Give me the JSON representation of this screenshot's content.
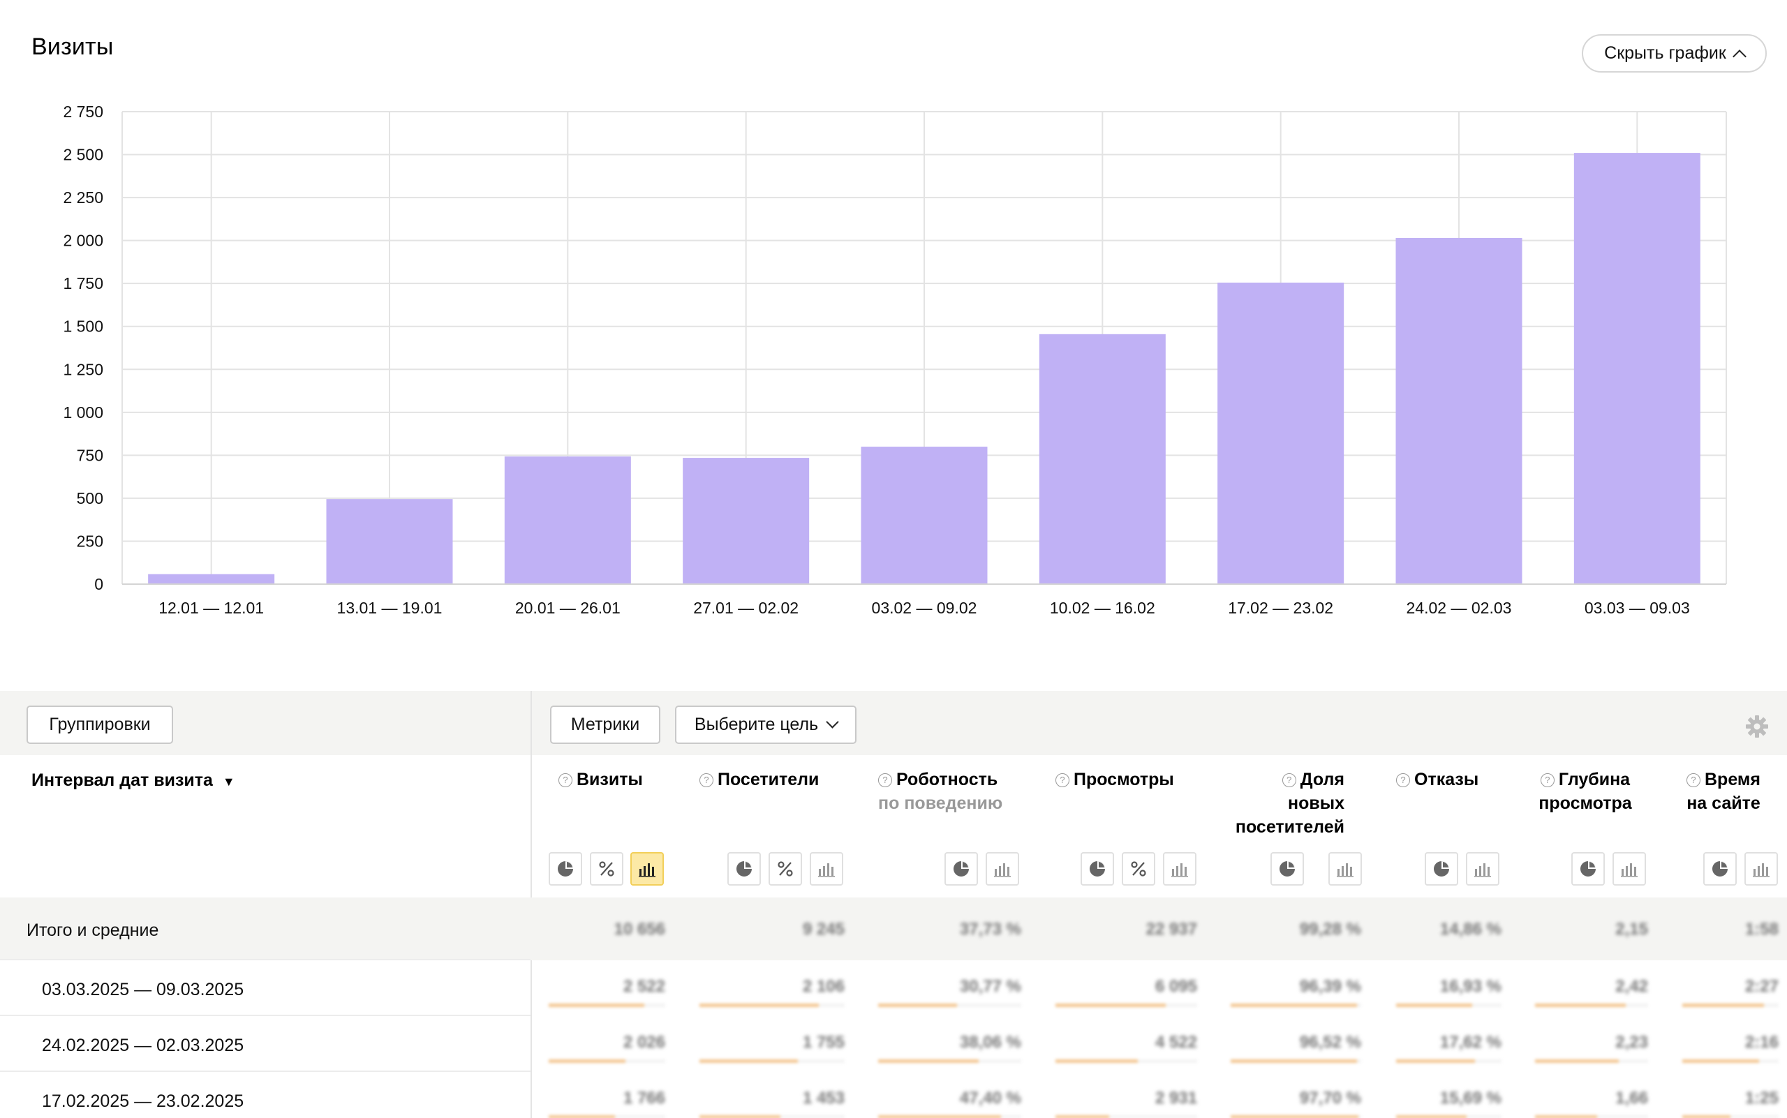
{
  "page": {
    "title": "Визиты",
    "hide_chart_label": "Скрыть график"
  },
  "chart_data": {
    "type": "bar",
    "title": "",
    "categories": [
      "12.01 — 12.01",
      "13.01 — 19.01",
      "20.01 — 26.01",
      "27.01 — 02.02",
      "03.02 — 09.02",
      "10.02 — 16.02",
      "17.02 — 23.02",
      "24.02 — 02.03",
      "03.03 — 09.03"
    ],
    "values": [
      58,
      495,
      743,
      735,
      800,
      1455,
      1755,
      2015,
      2510
    ],
    "yticks": [
      0,
      250,
      500,
      750,
      1000,
      1250,
      1500,
      1750,
      2000,
      2250,
      2500,
      2750
    ],
    "ytick_labels": [
      "0",
      "250",
      "500",
      "750",
      "1 000",
      "1 250",
      "1 500",
      "1 750",
      "2 000",
      "2 250",
      "2 500",
      "2 750"
    ],
    "ylim": [
      0,
      2750
    ],
    "grid": true,
    "color": "#c0b1f5"
  },
  "toolbar": {
    "groupings_label": "Группировки",
    "metrics_label": "Метрики",
    "goal_label": "Выберите цель",
    "settings_icon": "gear-icon"
  },
  "table": {
    "dimension_header": "Интервал дат визита",
    "sort_indicator": "▼",
    "columns": [
      {
        "label": "Визиты",
        "sub": ""
      },
      {
        "label": "Посетители",
        "sub": ""
      },
      {
        "label": "Роботность",
        "sub": "по поведению"
      },
      {
        "label": "Просмотры",
        "sub": ""
      },
      {
        "label": "Доля новых посетителей",
        "sub": ""
      },
      {
        "label": "Отказы",
        "sub": ""
      },
      {
        "label": "Глубина просмотра",
        "sub": ""
      },
      {
        "label": "Время на сайте",
        "sub": ""
      }
    ],
    "totals": {
      "label": "Итого и средние",
      "values": [
        "10 656",
        "9 245",
        "37,73 %",
        "22 937",
        "99,28 %",
        "14,86 %",
        "2,15",
        "1:58"
      ]
    },
    "rows": [
      {
        "label": "03.03.2025 — 09.03.2025",
        "values": [
          "2 522",
          "2 106",
          "30,77 %",
          "6 095",
          "96,39 %",
          "16,93 %",
          "2,42",
          "2:27"
        ],
        "shares": [
          0.82,
          0.82,
          0.55,
          0.78,
          0.97,
          0.72,
          0.8,
          0.85
        ]
      },
      {
        "label": "24.02.2025 — 02.03.2025",
        "values": [
          "2 026",
          "1 755",
          "38,06 %",
          "4 522",
          "96,52 %",
          "17,62 %",
          "2,23",
          "2:16"
        ],
        "shares": [
          0.66,
          0.68,
          0.7,
          0.58,
          0.97,
          0.75,
          0.74,
          0.8
        ]
      },
      {
        "label": "17.02.2025 — 23.02.2025",
        "values": [
          "1 766",
          "1 453",
          "47,40 %",
          "2 931",
          "97,70 %",
          "15,69 %",
          "1,66",
          "1:25"
        ],
        "shares": [
          0.57,
          0.56,
          0.86,
          0.38,
          0.98,
          0.67,
          0.55,
          0.5
        ]
      }
    ]
  }
}
